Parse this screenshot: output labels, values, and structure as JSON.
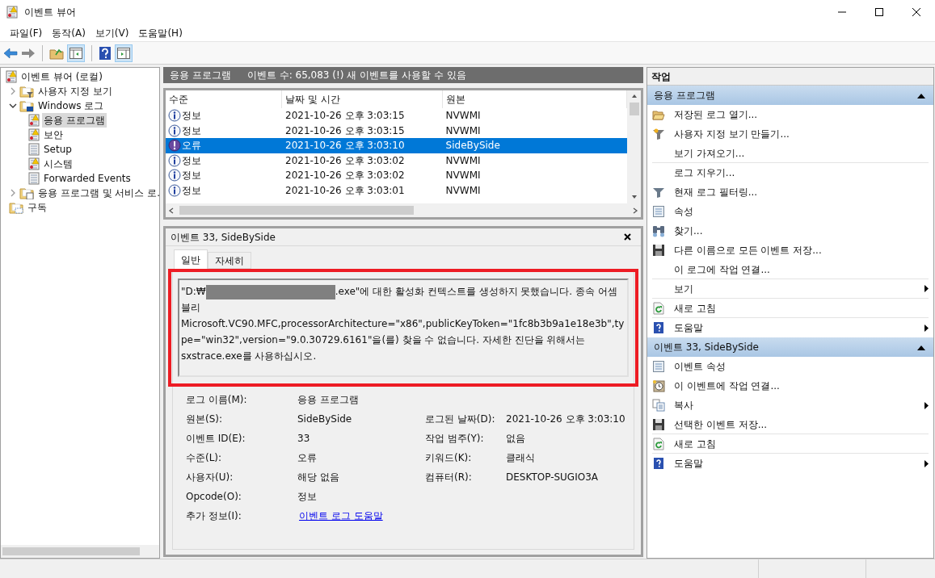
{
  "window": {
    "title": "이벤트 뷰어"
  },
  "menu": [
    "파일(F)",
    "동작(A)",
    "보기(V)",
    "도움말(H)"
  ],
  "tree": [
    {
      "label": "이벤트 뷰어 (로컬)",
      "kind": "log-warning",
      "selected": false,
      "children": [
        {
          "label": "사용자 지정 보기",
          "kind": "folder-filter",
          "expanded": false,
          "selected": false
        },
        {
          "label": "Windows 로그",
          "kind": "folder-computer",
          "expanded": true,
          "selected": false,
          "children": [
            {
              "label": "응용 프로그램",
              "kind": "log-warning",
              "selected": true
            },
            {
              "label": "보안",
              "kind": "log-warning",
              "selected": false
            },
            {
              "label": "Setup",
              "kind": "log-plain",
              "selected": false
            },
            {
              "label": "시스템",
              "kind": "log-warning",
              "selected": false
            },
            {
              "label": "Forwarded Events",
              "kind": "log-plain",
              "selected": false
            }
          ]
        },
        {
          "label": "응용 프로그램 및 서비스 로.",
          "kind": "folder-doc",
          "expanded": false,
          "selected": false
        },
        {
          "label": "구독",
          "kind": "folder-sub",
          "selected": false
        }
      ]
    }
  ],
  "center_header": {
    "title": "응용 프로그램",
    "info": "이벤트 수: 65,083 (!) 새 이벤트를 사용할 수 있음"
  },
  "events": {
    "columns": [
      "수준",
      "날짜 및 시간",
      "원본"
    ],
    "rows": [
      {
        "kind": "info",
        "level": "정보",
        "date": "2021-10-26 오후 3:03:15",
        "source": "NVWMI",
        "selected": false
      },
      {
        "kind": "info",
        "level": "정보",
        "date": "2021-10-26 오후 3:03:15",
        "source": "NVWMI",
        "selected": false
      },
      {
        "kind": "error",
        "level": "오류",
        "date": "2021-10-26 오후 3:03:10",
        "source": "SideBySide",
        "selected": true
      },
      {
        "kind": "info",
        "level": "정보",
        "date": "2021-10-26 오후 3:03:02",
        "source": "NVWMI",
        "selected": false
      },
      {
        "kind": "info",
        "level": "정보",
        "date": "2021-10-26 오후 3:03:02",
        "source": "NVWMI",
        "selected": false
      },
      {
        "kind": "info",
        "level": "정보",
        "date": "2021-10-26 오후 3:03:01",
        "source": "NVWMI",
        "selected": false
      }
    ]
  },
  "detail": {
    "title": "이벤트 33, SideBySide",
    "tabs": [
      {
        "label": "일반",
        "selected": true
      },
      {
        "label": "자세히",
        "selected": false
      }
    ],
    "message_start": "\"D:₩",
    "message_rest": ".exe\"에 대한 활성화 컨텍스트를 생성하지 못했습니다. 종속 어셈블리 Microsoft.VC90.MFC,processorArchitecture=\"x86\",publicKeyToken=\"1fc8b3b9a1e18e3b\",type=\"win32\",version=\"9.0.30729.6161\"을(를) 찾을 수 없습니다. 자세한 진단을 위해서는 sxstrace.exe를 사용하십시오.",
    "property_rows": [
      {
        "left": {
          "label": "로그 이름(M):",
          "value": "응용 프로그램"
        }
      },
      {
        "left": {
          "label": "원본(S):",
          "value": "SideBySide"
        },
        "right": {
          "label": "로그된 날짜(D):",
          "value": "2021-10-26 오후 3:03:10"
        }
      },
      {
        "left": {
          "label": "이벤트 ID(E):",
          "value": "33"
        },
        "right": {
          "label": "작업 범주(Y):",
          "value": "없음"
        }
      },
      {
        "left": {
          "label": "수준(L):",
          "value": "오류"
        },
        "right": {
          "label": "키워드(K):",
          "value": "클래식"
        }
      },
      {
        "left": {
          "label": "사용자(U):",
          "value": "해당 없음"
        },
        "right": {
          "label": "컴퓨터(R):",
          "value": "DESKTOP-SUGIO3A"
        }
      },
      {
        "left": {
          "label": "Opcode(O):",
          "value": "정보"
        }
      },
      {
        "left": {
          "label": "추가 정보(I):",
          "value": "이벤트 로그 도움말",
          "kind": "link"
        }
      }
    ]
  },
  "actions": {
    "title": "작업",
    "sections": [
      {
        "title": "응용 프로그램",
        "expanded": true,
        "items": [
          {
            "label": "저장된 로그 열기...",
            "kind": "open-folder",
            "submenu": false,
            "separator_after": false
          },
          {
            "label": "사용자 지정 보기 만들기...",
            "kind": "filter-star",
            "submenu": false,
            "separator_after": false
          },
          {
            "label": "보기 가져오기...",
            "kind": "none",
            "submenu": false,
            "separator_after": true
          },
          {
            "label": "로그 지우기...",
            "kind": "none",
            "submenu": false,
            "separator_after": false
          },
          {
            "label": "현재 로그 필터링...",
            "kind": "filter",
            "submenu": false,
            "separator_after": false
          },
          {
            "label": "속성",
            "kind": "properties",
            "submenu": false,
            "separator_after": false
          },
          {
            "label": "찾기...",
            "kind": "binoculars",
            "submenu": false,
            "separator_after": false
          },
          {
            "label": "다른 이름으로 모든 이벤트 저장...",
            "kind": "save",
            "submenu": false,
            "separator_after": false
          },
          {
            "label": "이 로그에 작업 연결...",
            "kind": "none",
            "submenu": false,
            "separator_after": true
          },
          {
            "label": "보기",
            "kind": "none",
            "submenu": true,
            "separator_after": true
          },
          {
            "label": "새로 고침",
            "kind": "refresh",
            "submenu": false,
            "separator_after": true
          },
          {
            "label": "도움말",
            "kind": "help",
            "submenu": true,
            "separator_after": false
          }
        ]
      },
      {
        "title": "이벤트 33, SideBySide",
        "expanded": true,
        "items": [
          {
            "label": "이벤트 속성",
            "kind": "properties",
            "submenu": false,
            "separator_after": false
          },
          {
            "label": "이 이벤트에 작업 연결...",
            "kind": "clock",
            "submenu": false,
            "separator_after": false
          },
          {
            "label": "복사",
            "kind": "copy",
            "submenu": true,
            "separator_after": false
          },
          {
            "label": "선택한 이벤트 저장...",
            "kind": "save",
            "submenu": false,
            "separator_after": true
          },
          {
            "label": "새로 고침",
            "kind": "refresh",
            "submenu": false,
            "separator_after": true
          },
          {
            "label": "도움말",
            "kind": "help",
            "submenu": true,
            "separator_after": false
          }
        ]
      }
    ]
  }
}
